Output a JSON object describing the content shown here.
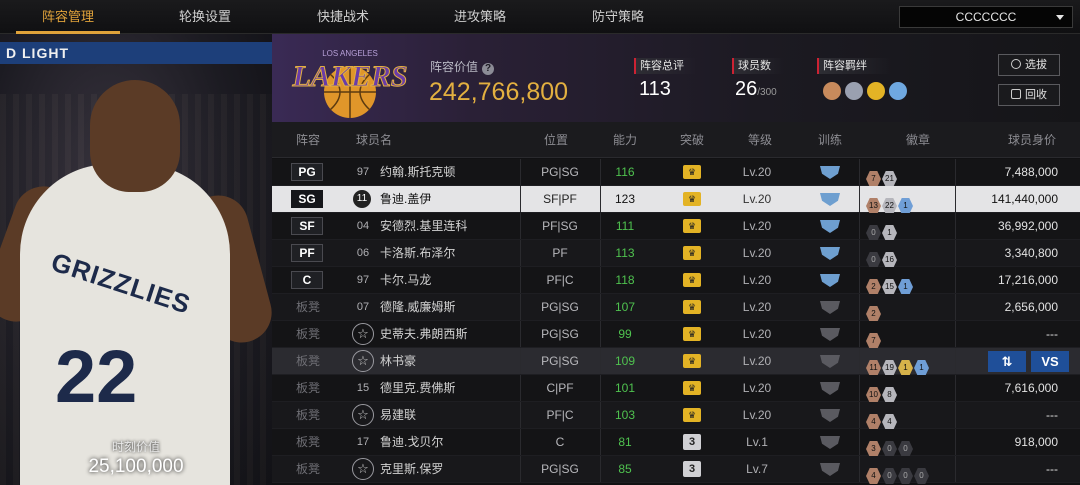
{
  "nav": {
    "tabs": [
      {
        "label": "阵容管理",
        "active": true
      },
      {
        "label": "轮换设置",
        "active": false
      },
      {
        "label": "快捷战术",
        "active": false
      },
      {
        "label": "进攻策略",
        "active": false
      },
      {
        "label": "防守策略",
        "active": false
      }
    ],
    "team_select": "CCCCCCC"
  },
  "player_panel": {
    "banner_text": "D LIGHT",
    "jersey_team": "GRIZZLIES",
    "jersey_number": "22",
    "value_label": "时刻价值",
    "value": "25,100,000"
  },
  "header": {
    "logo_team": "LAKERS",
    "logo_city": "LOS ANGELES",
    "lineup_value_label": "阵容价值",
    "lineup_value": "242,766,800",
    "overall_label": "阵容总评",
    "overall_value": "113",
    "players_label": "球员数",
    "players_value": "26",
    "players_max": "/300",
    "chemistry_label": "阵容羁绊",
    "chemistry_icon_colors": [
      "#c78a5c",
      "#9aa0b0",
      "#e3b325",
      "#6fa8e0"
    ],
    "select_button": "选拔",
    "recycle_button": "回收"
  },
  "table": {
    "columns": [
      "阵容",
      "球员名",
      "位置",
      "能力",
      "突破",
      "等级",
      "训练",
      "徽章",
      "球员身价"
    ],
    "rows": [
      {
        "slot": "PG",
        "starter": true,
        "number": "97",
        "name": "约翰.斯托克顿",
        "position": "PG|SG",
        "ability": "116",
        "breakthrough": "crown",
        "level": "Lv.20",
        "training": "on",
        "badges": [
          {
            "t": "bronze",
            "v": "7"
          },
          {
            "t": "silver",
            "v": "21"
          }
        ],
        "price": "7,488,000"
      },
      {
        "slot": "SG",
        "starter": true,
        "number": "11",
        "name": "鲁迪.盖伊",
        "position": "SF|PF",
        "ability": "123",
        "breakthrough": "crown",
        "level": "Lv.20",
        "training": "on",
        "badges": [
          {
            "t": "bronze",
            "v": "13"
          },
          {
            "t": "silver",
            "v": "22"
          },
          {
            "t": "blue",
            "v": "1"
          }
        ],
        "price": "141,440,000",
        "selected": true
      },
      {
        "slot": "SF",
        "starter": true,
        "number": "04",
        "name": "安德烈.基里连科",
        "position": "PF|SG",
        "ability": "111",
        "breakthrough": "crown",
        "level": "Lv.20",
        "training": "on",
        "badges": [
          {
            "t": "dark",
            "v": "0"
          },
          {
            "t": "silver",
            "v": "1"
          }
        ],
        "price": "36,992,000"
      },
      {
        "slot": "PF",
        "starter": true,
        "number": "06",
        "name": "卡洛斯.布泽尔",
        "position": "PF",
        "ability": "113",
        "breakthrough": "crown",
        "level": "Lv.20",
        "training": "on",
        "badges": [
          {
            "t": "dark",
            "v": "0"
          },
          {
            "t": "silver",
            "v": "16"
          }
        ],
        "price": "3,340,800"
      },
      {
        "slot": "C",
        "starter": true,
        "number": "97",
        "name": "卡尔.马龙",
        "position": "PF|C",
        "ability": "118",
        "breakthrough": "crown",
        "level": "Lv.20",
        "training": "on",
        "badges": [
          {
            "t": "bronze",
            "v": "2"
          },
          {
            "t": "silver",
            "v": "15"
          },
          {
            "t": "blue",
            "v": "1"
          }
        ],
        "price": "17,216,000"
      },
      {
        "slot": "板凳",
        "starter": false,
        "number": "07",
        "name": "德隆.威廉姆斯",
        "position": "PG|SG",
        "ability": "107",
        "breakthrough": "crown",
        "level": "Lv.20",
        "training": "off",
        "badges": [
          {
            "t": "bronze",
            "v": "2"
          }
        ],
        "price": "2,656,000"
      },
      {
        "slot": "板凳",
        "starter": false,
        "number": "",
        "name": "史蒂夫.弗朗西斯",
        "position": "PG|SG",
        "ability": "99",
        "breakthrough": "crown",
        "level": "Lv.20",
        "training": "off",
        "badges": [
          {
            "t": "bronze",
            "v": "7"
          }
        ],
        "price": "---"
      },
      {
        "slot": "板凳",
        "starter": false,
        "number": "",
        "name": "林书豪",
        "position": "PG|SG",
        "ability": "109",
        "breakthrough": "crown",
        "level": "Lv.20",
        "training": "off",
        "badges": [
          {
            "t": "bronze",
            "v": "11"
          },
          {
            "t": "silver",
            "v": "19"
          },
          {
            "t": "gold",
            "v": "1"
          },
          {
            "t": "blue",
            "v": "1"
          }
        ],
        "price": "",
        "hover": true
      },
      {
        "slot": "板凳",
        "starter": false,
        "number": "15",
        "name": "德里克.费佛斯",
        "position": "C|PF",
        "ability": "101",
        "breakthrough": "crown",
        "level": "Lv.20",
        "training": "off",
        "badges": [
          {
            "t": "bronze",
            "v": "10"
          },
          {
            "t": "silver",
            "v": "8"
          }
        ],
        "price": "7,616,000"
      },
      {
        "slot": "板凳",
        "starter": false,
        "number": "",
        "name": "易建联",
        "position": "PF|C",
        "ability": "103",
        "breakthrough": "crown",
        "level": "Lv.20",
        "training": "off",
        "badges": [
          {
            "t": "bronze",
            "v": "4"
          },
          {
            "t": "silver",
            "v": "4"
          }
        ],
        "price": "---"
      },
      {
        "slot": "板凳",
        "starter": false,
        "number": "17",
        "name": "鲁迪.戈贝尔",
        "position": "C",
        "ability": "81",
        "breakthrough": "3",
        "level": "Lv.1",
        "training": "off",
        "badges": [
          {
            "t": "bronze",
            "v": "3"
          },
          {
            "t": "dark",
            "v": "0"
          },
          {
            "t": "dark",
            "v": "0"
          }
        ],
        "price": "918,000"
      },
      {
        "slot": "板凳",
        "starter": false,
        "number": "",
        "name": "克里斯.保罗",
        "position": "PG|SG",
        "ability": "85",
        "breakthrough": "3",
        "level": "Lv.7",
        "training": "off",
        "badges": [
          {
            "t": "bronze",
            "v": "4"
          },
          {
            "t": "dark",
            "v": "0"
          },
          {
            "t": "dark",
            "v": "0"
          },
          {
            "t": "dark",
            "v": "0"
          }
        ],
        "price": "---"
      }
    ],
    "hover_actions": {
      "swap": "⇅",
      "vs": "VS"
    }
  }
}
